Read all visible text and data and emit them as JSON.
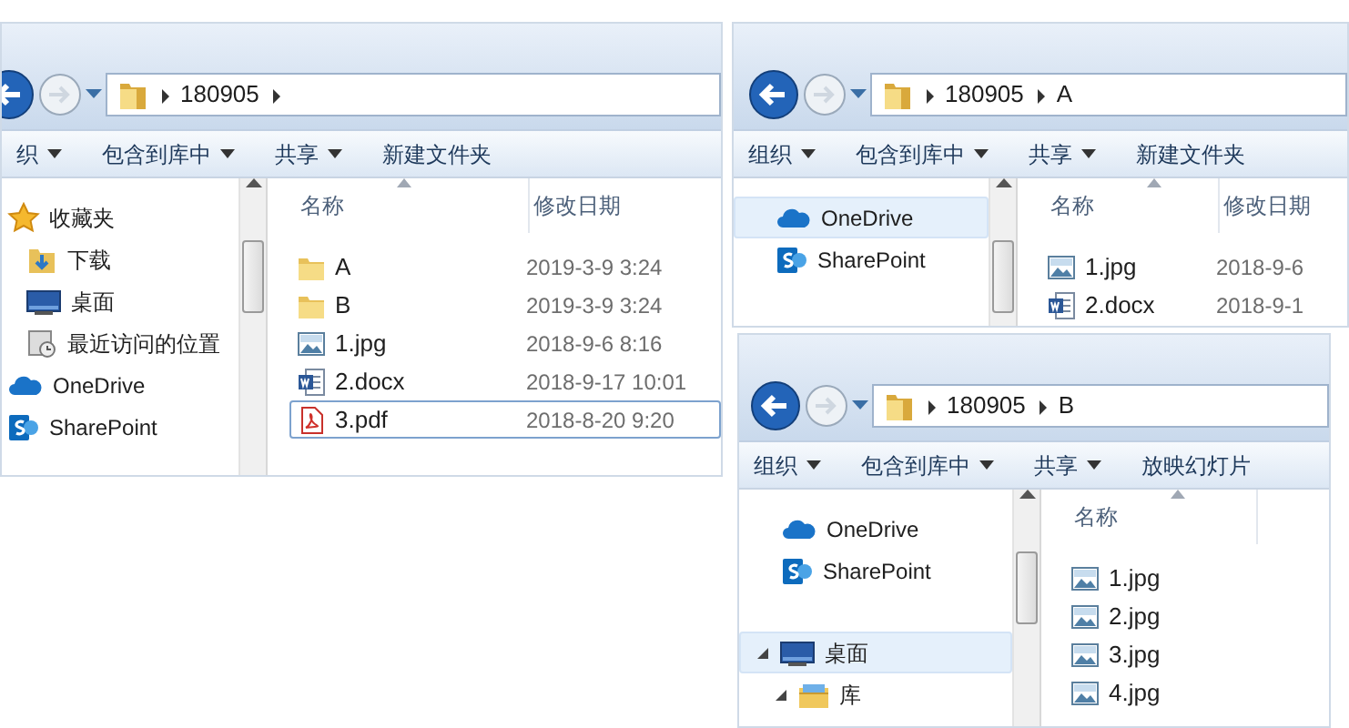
{
  "windows": [
    {
      "path": [
        "180905"
      ],
      "more": true,
      "toolbar": [
        {
          "label": "织",
          "menu": true
        },
        {
          "label": "包含到库中",
          "menu": true
        },
        {
          "label": "共享",
          "menu": true
        },
        {
          "label": "新建文件夹",
          "menu": false
        }
      ],
      "nav_groups": [
        [
          {
            "label": "收藏夹",
            "kind": "star",
            "selected": false,
            "children": [
              {
                "label": "下载",
                "kind": "download",
                "selected": false
              },
              {
                "label": "桌面",
                "kind": "desktop",
                "selected": false
              },
              {
                "label": "最近访问的位置",
                "kind": "recent",
                "selected": false
              }
            ]
          },
          {
            "label": "OneDrive",
            "kind": "onedrive",
            "selected": false
          },
          {
            "label": "SharePoint",
            "kind": "sharepoint",
            "selected": false
          }
        ]
      ],
      "columns": [
        {
          "label": "名称",
          "sorted": true
        },
        {
          "label": "修改日期"
        }
      ],
      "files": [
        {
          "name": "A",
          "kind": "folder",
          "modified": "2019-3-9 3:24",
          "focused": false
        },
        {
          "name": "B",
          "kind": "folder",
          "modified": "2019-3-9 3:24",
          "focused": false
        },
        {
          "name": "1.jpg",
          "kind": "image",
          "modified": "2018-9-6 8:16",
          "focused": false
        },
        {
          "name": "2.docx",
          "kind": "word",
          "modified": "2018-9-17 10:01",
          "focused": false
        },
        {
          "name": "3.pdf",
          "kind": "pdf",
          "modified": "2018-8-20 9:20",
          "focused": true
        }
      ]
    },
    {
      "path": [
        "180905",
        "A"
      ],
      "toolbar": [
        {
          "label": "组织",
          "menu": true
        },
        {
          "label": "包含到库中",
          "menu": true
        },
        {
          "label": "共享",
          "menu": true
        },
        {
          "label": "新建文件夹",
          "menu": false
        }
      ],
      "nav_groups": [
        [
          {
            "label": "OneDrive",
            "kind": "onedrive",
            "selected": true
          },
          {
            "label": "SharePoint",
            "kind": "sharepoint",
            "selected": false
          }
        ]
      ],
      "columns": [
        {
          "label": "名称",
          "sorted": true
        },
        {
          "label": "修改日期"
        }
      ],
      "files": [
        {
          "name": "1.jpg",
          "kind": "image",
          "modified": "2018-9-6",
          "focused": false
        },
        {
          "name": "2.docx",
          "kind": "word",
          "modified": "2018-9-1",
          "focused": false
        }
      ]
    },
    {
      "path": [
        "180905",
        "B"
      ],
      "toolbar": [
        {
          "label": "组织",
          "menu": true
        },
        {
          "label": "包含到库中",
          "menu": true
        },
        {
          "label": "共享",
          "menu": true
        },
        {
          "label": "放映幻灯片",
          "menu": false
        }
      ],
      "nav_groups": [
        [
          {
            "label": "OneDrive",
            "kind": "onedrive",
            "selected": false
          },
          {
            "label": "SharePoint",
            "kind": "sharepoint",
            "selected": false
          }
        ],
        [
          {
            "label": "桌面",
            "kind": "desktop",
            "selected": true,
            "expanded": true,
            "children": [
              {
                "label": "库",
                "kind": "library",
                "selected": false,
                "expanded": true
              }
            ]
          }
        ]
      ],
      "columns": [
        {
          "label": "名称",
          "sorted": true
        }
      ],
      "files": [
        {
          "name": "1.jpg",
          "kind": "image",
          "focused": false
        },
        {
          "name": "2.jpg",
          "kind": "image",
          "focused": false
        },
        {
          "name": "3.jpg",
          "kind": "image",
          "focused": false
        },
        {
          "name": "4.jpg",
          "kind": "image",
          "focused": false
        }
      ]
    }
  ]
}
